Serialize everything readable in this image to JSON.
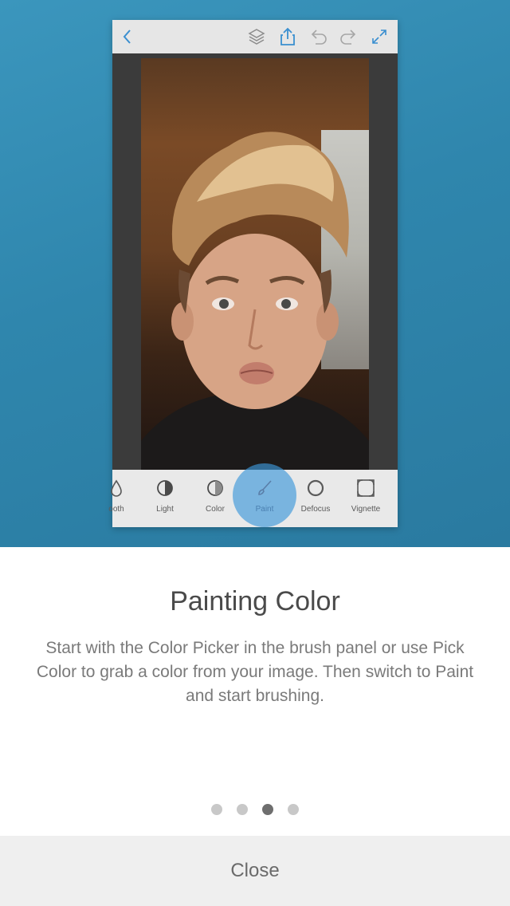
{
  "colors": {
    "hero_background": "#3090b8",
    "accent": "#2a8bd0",
    "text_title": "#4a4a4a",
    "text_body": "#7a7a7a",
    "dot_inactive": "#c8c8c8",
    "dot_active": "#6e6e6e"
  },
  "phone": {
    "toolbar_icons": [
      "back-icon",
      "layers-icon",
      "share-icon",
      "undo-icon",
      "redo-icon",
      "fullscreen-icon"
    ],
    "tools": [
      {
        "label": "ooth",
        "icon": "drop-icon"
      },
      {
        "label": "Light",
        "icon": "half-circle-icon"
      },
      {
        "label": "Color",
        "icon": "half-circle-icon"
      },
      {
        "label": "Paint",
        "icon": "brush-icon",
        "active": true
      },
      {
        "label": "Defocus",
        "icon": "circle-icon"
      },
      {
        "label": "Vignette",
        "icon": "vignette-icon"
      }
    ]
  },
  "slide": {
    "title": "Painting Color",
    "body": "Start with the Color Picker in the brush panel or use Pick Color to grab a color from your image. Then switch to Paint and start brushing."
  },
  "pagination": {
    "total": 4,
    "current": 3
  },
  "footer": {
    "close_label": "Close"
  }
}
